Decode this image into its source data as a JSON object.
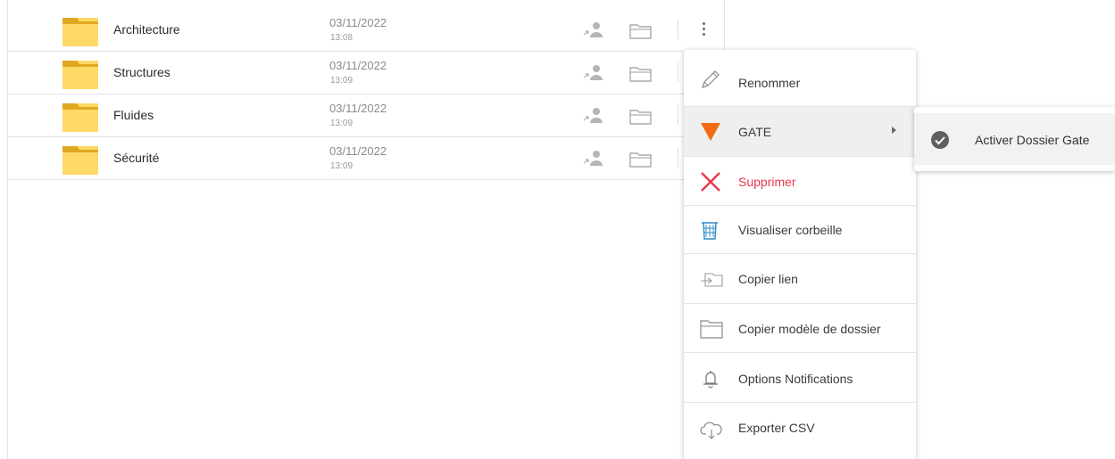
{
  "folders": [
    {
      "name": "Architecture",
      "date": "03/11/2022",
      "time": "13:08"
    },
    {
      "name": "Structures",
      "date": "03/11/2022",
      "time": "13:09"
    },
    {
      "name": "Fluides",
      "date": "03/11/2022",
      "time": "13:09"
    },
    {
      "name": "Sécurité",
      "date": "03/11/2022",
      "time": "13:09"
    }
  ],
  "context_menu": {
    "items": [
      {
        "label": "Renommer",
        "icon": "pencil-icon"
      },
      {
        "label": "GATE",
        "icon": "gate-triangle-icon"
      },
      {
        "label": "Supprimer",
        "icon": "delete-x-icon"
      },
      {
        "label": "Visualiser corbeille",
        "icon": "trash-icon"
      },
      {
        "label": "Copier lien",
        "icon": "link-icon"
      },
      {
        "label": "Copier modèle de dossier",
        "icon": "folder-template-icon"
      },
      {
        "label": "Options Notifications",
        "icon": "bell-icon"
      },
      {
        "label": "Exporter CSV",
        "icon": "cloud-download-icon"
      }
    ]
  },
  "submenu": {
    "items": [
      {
        "label": "Activer Dossier Gate",
        "icon": "check-circle-icon"
      }
    ]
  },
  "colors": {
    "folder": "#FFD966",
    "folder_tab": "#E0A820",
    "gate_orange": "#F26A11",
    "danger": "#E8364A",
    "trash_blue": "#2E87C8"
  }
}
